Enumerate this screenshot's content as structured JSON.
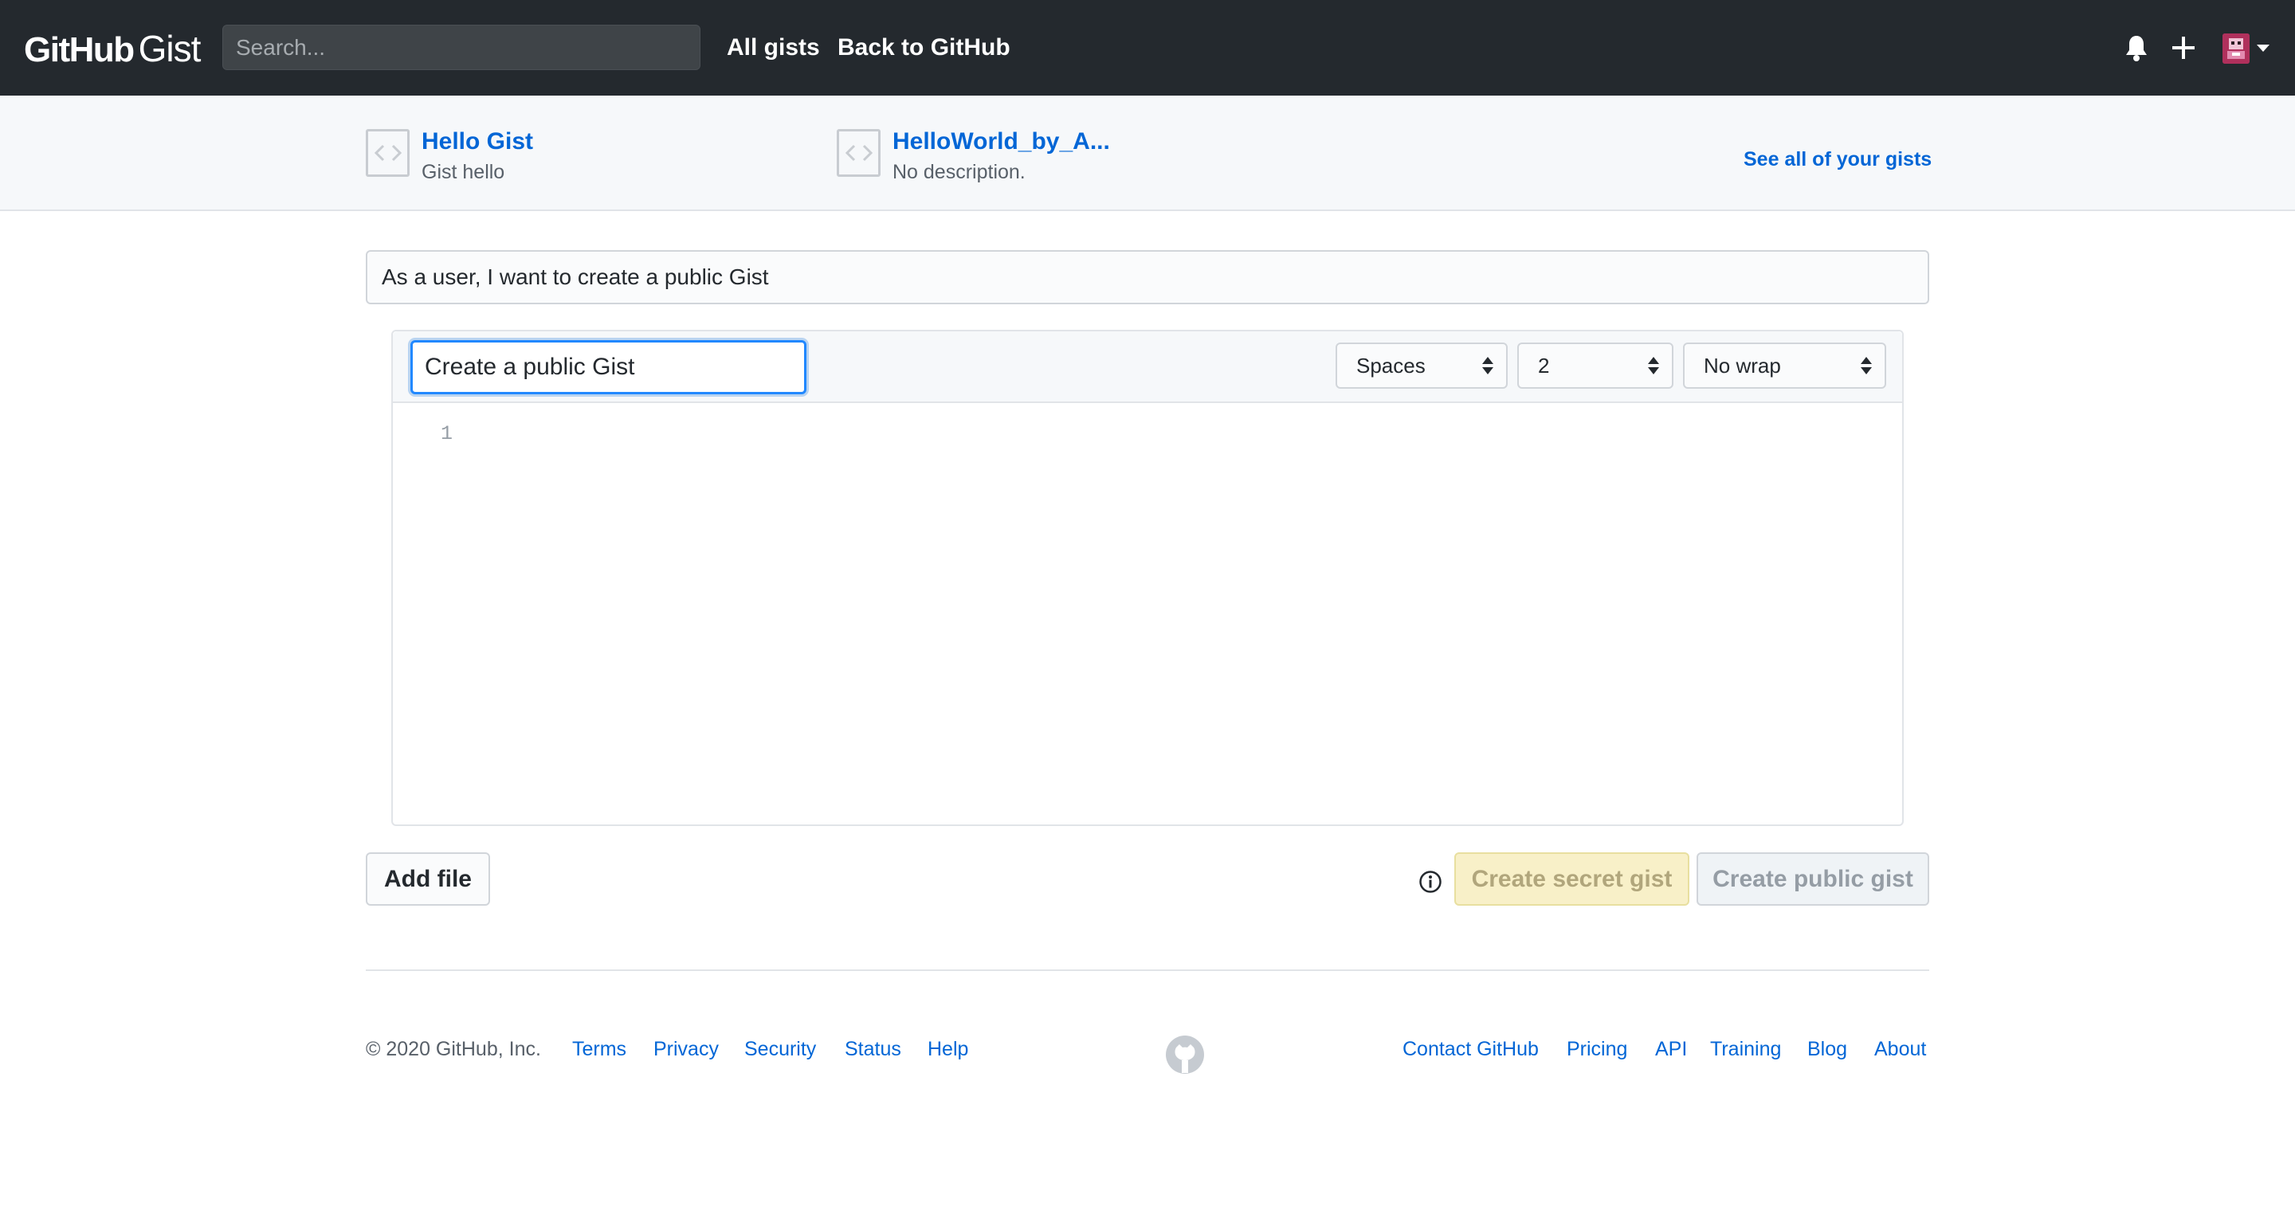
{
  "header": {
    "logo_github": "GitHub",
    "logo_gist": "Gist",
    "search_placeholder": "Search...",
    "nav_all": "All gists",
    "nav_back": "Back to GitHub",
    "icons": [
      "bell-icon",
      "plus-icon",
      "avatar",
      "caret-down-icon"
    ]
  },
  "recent": {
    "gists": [
      {
        "title": "Hello Gist",
        "description": "Gist hello",
        "icon": "code-icon"
      },
      {
        "title": "HelloWorld_by_A...",
        "description": "No description.",
        "icon": "code-icon"
      }
    ],
    "see_all": "See all of your gists"
  },
  "editor": {
    "description_value": "As a user, I want to create a public Gist",
    "filename_value": "Create a public Gist",
    "indent_mode": "Spaces",
    "indent_size": "2",
    "wrap_mode": "No wrap",
    "line_number": "1"
  },
  "actions": {
    "add_file": "Add file",
    "create_secret": "Create secret gist",
    "create_public": "Create public gist",
    "info_icon": "info-icon"
  },
  "footer": {
    "copyright": "© 2020 GitHub, Inc.",
    "left_links": [
      "Terms",
      "Privacy",
      "Security",
      "Status",
      "Help"
    ],
    "right_links": [
      "Contact GitHub",
      "Pricing",
      "API",
      "Training",
      "Blog",
      "About"
    ],
    "mark_icon": "github-mark-icon"
  },
  "colors": {
    "header_bg": "#24292e",
    "link": "#0366d6",
    "focus": "#2188ff",
    "secret_bg": "#f8f0c8"
  }
}
